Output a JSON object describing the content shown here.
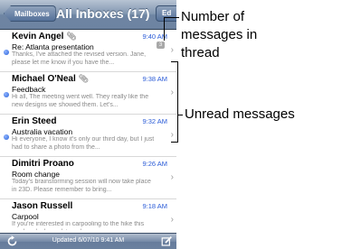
{
  "navbar": {
    "back_label": "Mailboxes",
    "title": "All Inboxes (17)",
    "edit_label": "Ed"
  },
  "messages": [
    {
      "sender": "Kevin Angel",
      "attachment": true,
      "time": "9:40 AM",
      "subject": "Re: Atlanta presentation",
      "preview": "Thanks, I've attached the revised version. Jane, please let me know if you have the...",
      "unread": true,
      "thread_count": "3"
    },
    {
      "sender": "Michael O'Neal",
      "attachment": true,
      "time": "9:38 AM",
      "subject": "Feedback",
      "preview": "Hi all, The meeting went well. They really like the new designs we showed them. Let's...",
      "unread": true,
      "thread_count": null
    },
    {
      "sender": "Erin Steed",
      "attachment": false,
      "time": "9:32 AM",
      "subject": "Australia vacation",
      "preview": "Hi everyone, I know it's only our third day, but I just had to share a photo from the...",
      "unread": true,
      "thread_count": null
    },
    {
      "sender": "Dimitri Proano",
      "attachment": false,
      "time": "9:26 AM",
      "subject": "Room change",
      "preview": "Today's brainstorming session will now take place in 23D. Please remember to bring...",
      "unread": false,
      "thread_count": null
    },
    {
      "sender": "Jason Russell",
      "attachment": false,
      "time": "9:18 AM",
      "subject": "Carpool",
      "preview": "If you're interested in carpooling to the hike this weekend, please let me know...",
      "unread": false,
      "thread_count": null
    }
  ],
  "toolbar": {
    "status": "Updated 6/07/10 9:41 AM"
  },
  "annotations": {
    "thread_count_label": [
      "Number of",
      "messages in",
      "thread"
    ],
    "unread_label": "Unread messages"
  },
  "icons": {
    "refresh": "refresh-icon",
    "compose": "compose-icon",
    "attachment": "paperclip-icon",
    "chevron": "chevron-right-icon"
  }
}
